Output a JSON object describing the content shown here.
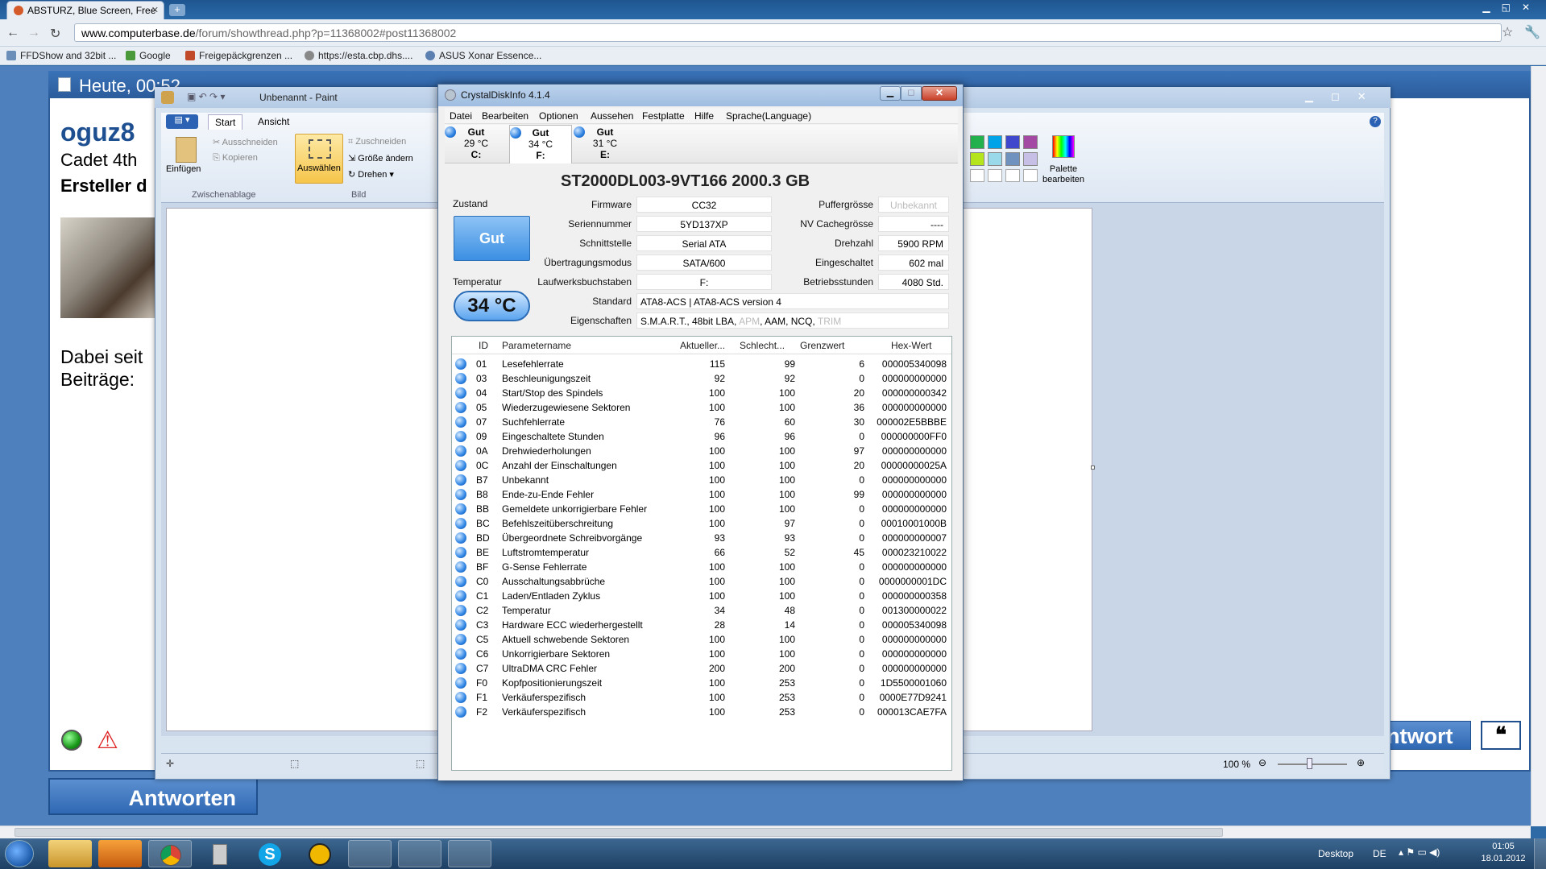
{
  "browser": {
    "tab_title": "ABSTURZ, Blue Screen, Free",
    "url_domain": "www.computerbase.de",
    "url_path": "/forum/showthread.php?p=11368002#post11368002",
    "bookmarks": [
      "FFDShow and 32bit ...",
      "Google",
      "Freigepäckgrenzen ...",
      "https://esta.cbp.dhs....",
      "ASUS Xonar Essence..."
    ]
  },
  "forum": {
    "date_header": "Heute, 00:52",
    "username": "oguz8",
    "rank": "Cadet 4th",
    "creator_label": "Ersteller d",
    "since_label": "Dabei seit",
    "posts_label": "Beiträge:",
    "answer_button": "Antworten",
    "answer_button_partial": "ntwort"
  },
  "paint": {
    "title": "Unbenannt - Paint",
    "tabs": [
      "Start",
      "Ansicht"
    ],
    "paste_label": "Einfügen",
    "cut_label": "Ausschneiden",
    "copy_label": "Kopieren",
    "clipboard_group": "Zwischenablage",
    "select_label": "Auswählen",
    "crop_label": "Zuschneiden",
    "resize_label": "Größe ändern",
    "rotate_label": "Drehen",
    "image_group": "Bild",
    "palette_label": "Palette bearbeiten",
    "zoom": "100 %"
  },
  "cdi": {
    "title": "CrystalDiskInfo 4.1.4",
    "menu": [
      "Datei",
      "Bearbeiten",
      "Optionen",
      "Aussehen",
      "Festplatte",
      "Hilfe",
      "Sprache(Language)"
    ],
    "drives": [
      {
        "status": "Gut",
        "temp": "29 °C",
        "letter": "C:"
      },
      {
        "status": "Gut",
        "temp": "34 °C",
        "letter": "F:"
      },
      {
        "status": "Gut",
        "temp": "31 °C",
        "letter": "E:"
      }
    ],
    "model": "ST2000DL003-9VT166  2000.3 GB",
    "zustand_label": "Zustand",
    "health": "Gut",
    "temperatur_label": "Temperatur",
    "temperature": "34 °C",
    "fields": {
      "firmware_label": "Firmware",
      "firmware": "CC32",
      "serial_label": "Seriennummer",
      "serial": "5YD137XP",
      "interface_label": "Schnittstelle",
      "interface": "Serial ATA",
      "transfer_label": "Übertragungsmodus",
      "transfer": "SATA/600",
      "drive_letter_label": "Laufwerksbuchstaben",
      "drive_letter": "F:",
      "standard_label": "Standard",
      "standard": "ATA8-ACS | ATA8-ACS version 4",
      "features_label": "Eigenschaften",
      "features": "S.M.A.R.T., 48bit LBA,",
      "features_apm": "APM",
      "features_mid": ", AAM, NCQ,",
      "features_trim": "TRIM",
      "buffer_label": "Puffergrösse",
      "buffer": "Unbekannt",
      "nvcache_label": "NV Cachegrösse",
      "nvcache": "----",
      "rpm_label": "Drehzahl",
      "rpm": "5900 RPM",
      "poweron_count_label": "Eingeschaltet",
      "poweron_count": "602 mal",
      "hours_label": "Betriebsstunden",
      "hours": "4080 Std."
    },
    "smart_headers": [
      "ID",
      "Parametername",
      "Aktueller...",
      "Schlecht...",
      "Grenzwert",
      "Hex-Wert"
    ],
    "smart_rows": [
      [
        "01",
        "Lesefehlerrate",
        "115",
        "99",
        "6",
        "000005340098"
      ],
      [
        "03",
        "Beschleunigungszeit",
        "92",
        "92",
        "0",
        "000000000000"
      ],
      [
        "04",
        "Start/Stop des Spindels",
        "100",
        "100",
        "20",
        "000000000342"
      ],
      [
        "05",
        "Wiederzugewiesene Sektoren",
        "100",
        "100",
        "36",
        "000000000000"
      ],
      [
        "07",
        "Suchfehlerrate",
        "76",
        "60",
        "30",
        "000002E5BBBE"
      ],
      [
        "09",
        "Eingeschaltete Stunden",
        "96",
        "96",
        "0",
        "000000000FF0"
      ],
      [
        "0A",
        "Drehwiederholungen",
        "100",
        "100",
        "97",
        "000000000000"
      ],
      [
        "0C",
        "Anzahl der Einschaltungen",
        "100",
        "100",
        "20",
        "00000000025A"
      ],
      [
        "B7",
        "Unbekannt",
        "100",
        "100",
        "0",
        "000000000000"
      ],
      [
        "B8",
        "Ende-zu-Ende Fehler",
        "100",
        "100",
        "99",
        "000000000000"
      ],
      [
        "BB",
        "Gemeldete unkorrigierbare Fehler",
        "100",
        "100",
        "0",
        "000000000000"
      ],
      [
        "BC",
        "Befehlszeitüberschreitung",
        "100",
        "97",
        "0",
        "00010001000B"
      ],
      [
        "BD",
        "Übergeordnete Schreibvorgänge",
        "93",
        "93",
        "0",
        "000000000007"
      ],
      [
        "BE",
        "Luftstromtemperatur",
        "66",
        "52",
        "45",
        "000023210022"
      ],
      [
        "BF",
        "G-Sense Fehlerrate",
        "100",
        "100",
        "0",
        "000000000000"
      ],
      [
        "C0",
        "Ausschaltungsabbrüche",
        "100",
        "100",
        "0",
        "0000000001DC"
      ],
      [
        "C1",
        "Laden/Entladen Zyklus",
        "100",
        "100",
        "0",
        "000000000358"
      ],
      [
        "C2",
        "Temperatur",
        "34",
        "48",
        "0",
        "001300000022"
      ],
      [
        "C3",
        "Hardware ECC wiederhergestellt",
        "28",
        "14",
        "0",
        "000005340098"
      ],
      [
        "C5",
        "Aktuell schwebende Sektoren",
        "100",
        "100",
        "0",
        "000000000000"
      ],
      [
        "C6",
        "Unkorrigierbare Sektoren",
        "100",
        "100",
        "0",
        "000000000000"
      ],
      [
        "C7",
        "UltraDMA CRC Fehler",
        "200",
        "200",
        "0",
        "000000000000"
      ],
      [
        "F0",
        "Kopfpositionierungszeit",
        "100",
        "253",
        "0",
        "1D5500001060"
      ],
      [
        "F1",
        "Verkäuferspezifisch",
        "100",
        "253",
        "0",
        "0000E77D9241"
      ],
      [
        "F2",
        "Verkäuferspezifisch",
        "100",
        "253",
        "0",
        "000013CAE7FA"
      ]
    ]
  },
  "taskbar": {
    "desktop_label": "Desktop",
    "lang": "DE",
    "time": "01:05",
    "date": "18.01.2012"
  }
}
